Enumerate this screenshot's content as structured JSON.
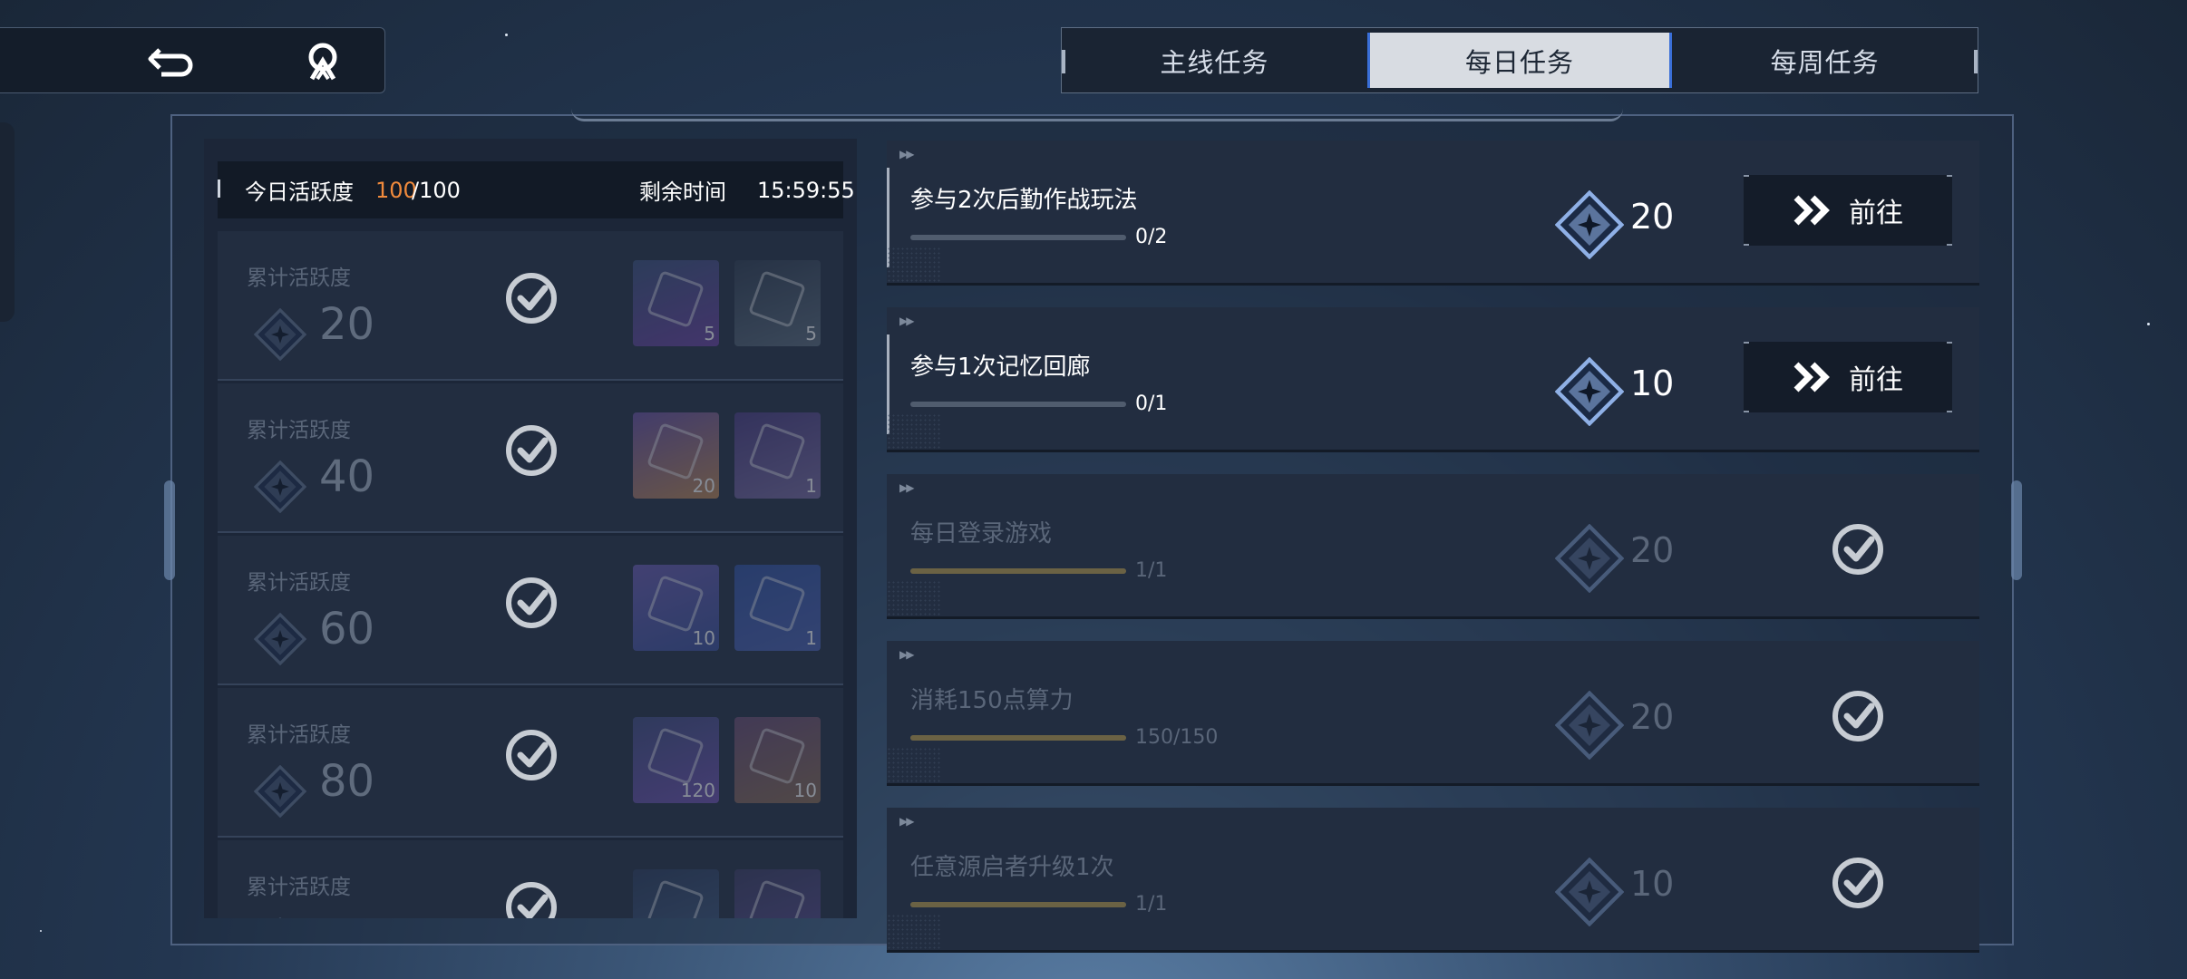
{
  "header": {
    "back_icon": "back-arrow-icon",
    "home_icon": "base-logo-icon"
  },
  "tabs": [
    {
      "label": "主线任务",
      "active": false
    },
    {
      "label": "每日任务",
      "active": true
    },
    {
      "label": "每周任务",
      "active": false
    }
  ],
  "activity": {
    "label": "今日活跃度",
    "current": "100",
    "max": "/100",
    "remaining_label": "剩余时间",
    "remaining_time": "15:59:55",
    "accent": "#f08a3c"
  },
  "tiers": [
    {
      "label": "累计活跃度",
      "value": "20",
      "claimed": true,
      "rewards": [
        {
          "qty": "5",
          "icon": "purple-ticket-icon"
        },
        {
          "qty": "5",
          "icon": "usb-key-icon"
        }
      ]
    },
    {
      "label": "累计活跃度",
      "value": "40",
      "claimed": true,
      "rewards": [
        {
          "qty": "20",
          "icon": "crystal-star-icon"
        },
        {
          "qty": "1",
          "icon": "supply-chest-icon"
        }
      ]
    },
    {
      "label": "累计活跃度",
      "value": "60",
      "claimed": true,
      "rewards": [
        {
          "qty": "10",
          "icon": "crystal-shard-icon"
        },
        {
          "qty": "1",
          "icon": "blue-badge-icon"
        }
      ]
    },
    {
      "label": "累计活跃度",
      "value": "80",
      "claimed": true,
      "rewards": [
        {
          "qty": "120",
          "icon": "planet-orb-icon"
        },
        {
          "qty": "10",
          "icon": "prism-cube-icon"
        }
      ]
    },
    {
      "label": "累计活跃度",
      "value": "",
      "claimed": true,
      "rewards": [
        {
          "qty": "",
          "icon": "blue-card-icon"
        },
        {
          "qty": "",
          "icon": "purple-tool-icon"
        }
      ]
    }
  ],
  "tasks": [
    {
      "title": "参与2次后勤作战玩法",
      "progress": "0/2",
      "fraction": 0,
      "points": "20",
      "state": "go",
      "button_label": "前往"
    },
    {
      "title": "参与1次记忆回廊",
      "progress": "0/1",
      "fraction": 0,
      "points": "10",
      "state": "go",
      "button_label": "前往"
    },
    {
      "title": "每日登录游戏",
      "progress": "1/1",
      "fraction": 1,
      "points": "20",
      "state": "done"
    },
    {
      "title": "消耗150点算力",
      "progress": "150/150",
      "fraction": 1,
      "points": "20",
      "state": "done"
    },
    {
      "title": "任意源启者升级1次",
      "progress": "1/1",
      "fraction": 1,
      "points": "10",
      "state": "done"
    }
  ]
}
